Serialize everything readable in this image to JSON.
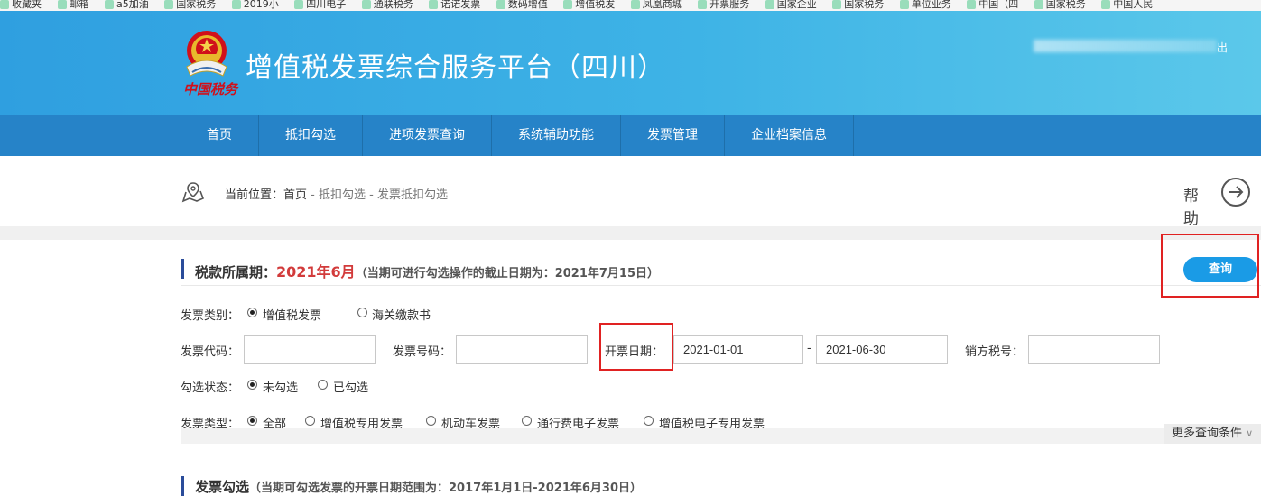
{
  "bookmarks": [
    "收藏夹",
    "邮箱",
    "a5加油",
    "国家税务",
    "2019小",
    "四川电子",
    "通联税务",
    "诺诺发票",
    "数码增值",
    "增值税发",
    "凤凰商城",
    "开票服务",
    "国家企业",
    "国家税务",
    "单位业务",
    "中国（四",
    "国家税务",
    "中国人民"
  ],
  "header": {
    "logo_text": "中国税务",
    "title": "增值税发票综合服务平台（四川）",
    "logout": "出"
  },
  "nav": {
    "items": [
      "首页",
      "抵扣勾选",
      "进项发票查询",
      "系统辅助功能",
      "发票管理",
      "企业档案信息"
    ]
  },
  "breadcrumb": {
    "prefix": "当前位置：",
    "home": "首页",
    "sep": " - ",
    "level1": "抵扣勾选",
    "level2": "发票抵扣勾选"
  },
  "help": {
    "label": "帮助"
  },
  "tax_section": {
    "label": "税款所属期：",
    "period": "2021年6月",
    "note": "（当期可进行勾选操作的截止日期为：2021年7月15日）",
    "query_button": "查询"
  },
  "form": {
    "invoice_category_label": "发票类别：",
    "invoice_category_options": [
      "增值税发票",
      "海关缴款书"
    ],
    "invoice_code_label": "发票代码：",
    "invoice_code_value": "",
    "invoice_number_label": "发票号码：",
    "invoice_number_value": "",
    "issue_date_label": "开票日期：",
    "date_from": "2021-01-01",
    "date_sep": "-",
    "date_to": "2021-06-30",
    "seller_tax_label": "销方税号：",
    "seller_tax_value": "",
    "select_status_label": "勾选状态：",
    "select_status_options": [
      "未勾选",
      "已勾选"
    ],
    "invoice_type_label": "发票类型：",
    "invoice_type_options": [
      "全部",
      "增值税专用发票",
      "机动车发票",
      "通行费电子发票",
      "增值税电子专用发票"
    ],
    "more_conditions": "更多查询条件"
  },
  "select_section": {
    "label": "发票勾选",
    "note": "（当期可勾选发票的开票日期范围为：2017年1月1日-2021年6月30日）"
  },
  "colors": {
    "header": "#3aaee5",
    "nav": "#2683c8",
    "accent_red": "#d23b3b",
    "button": "#1a9be6",
    "highlight": "#e02222"
  }
}
